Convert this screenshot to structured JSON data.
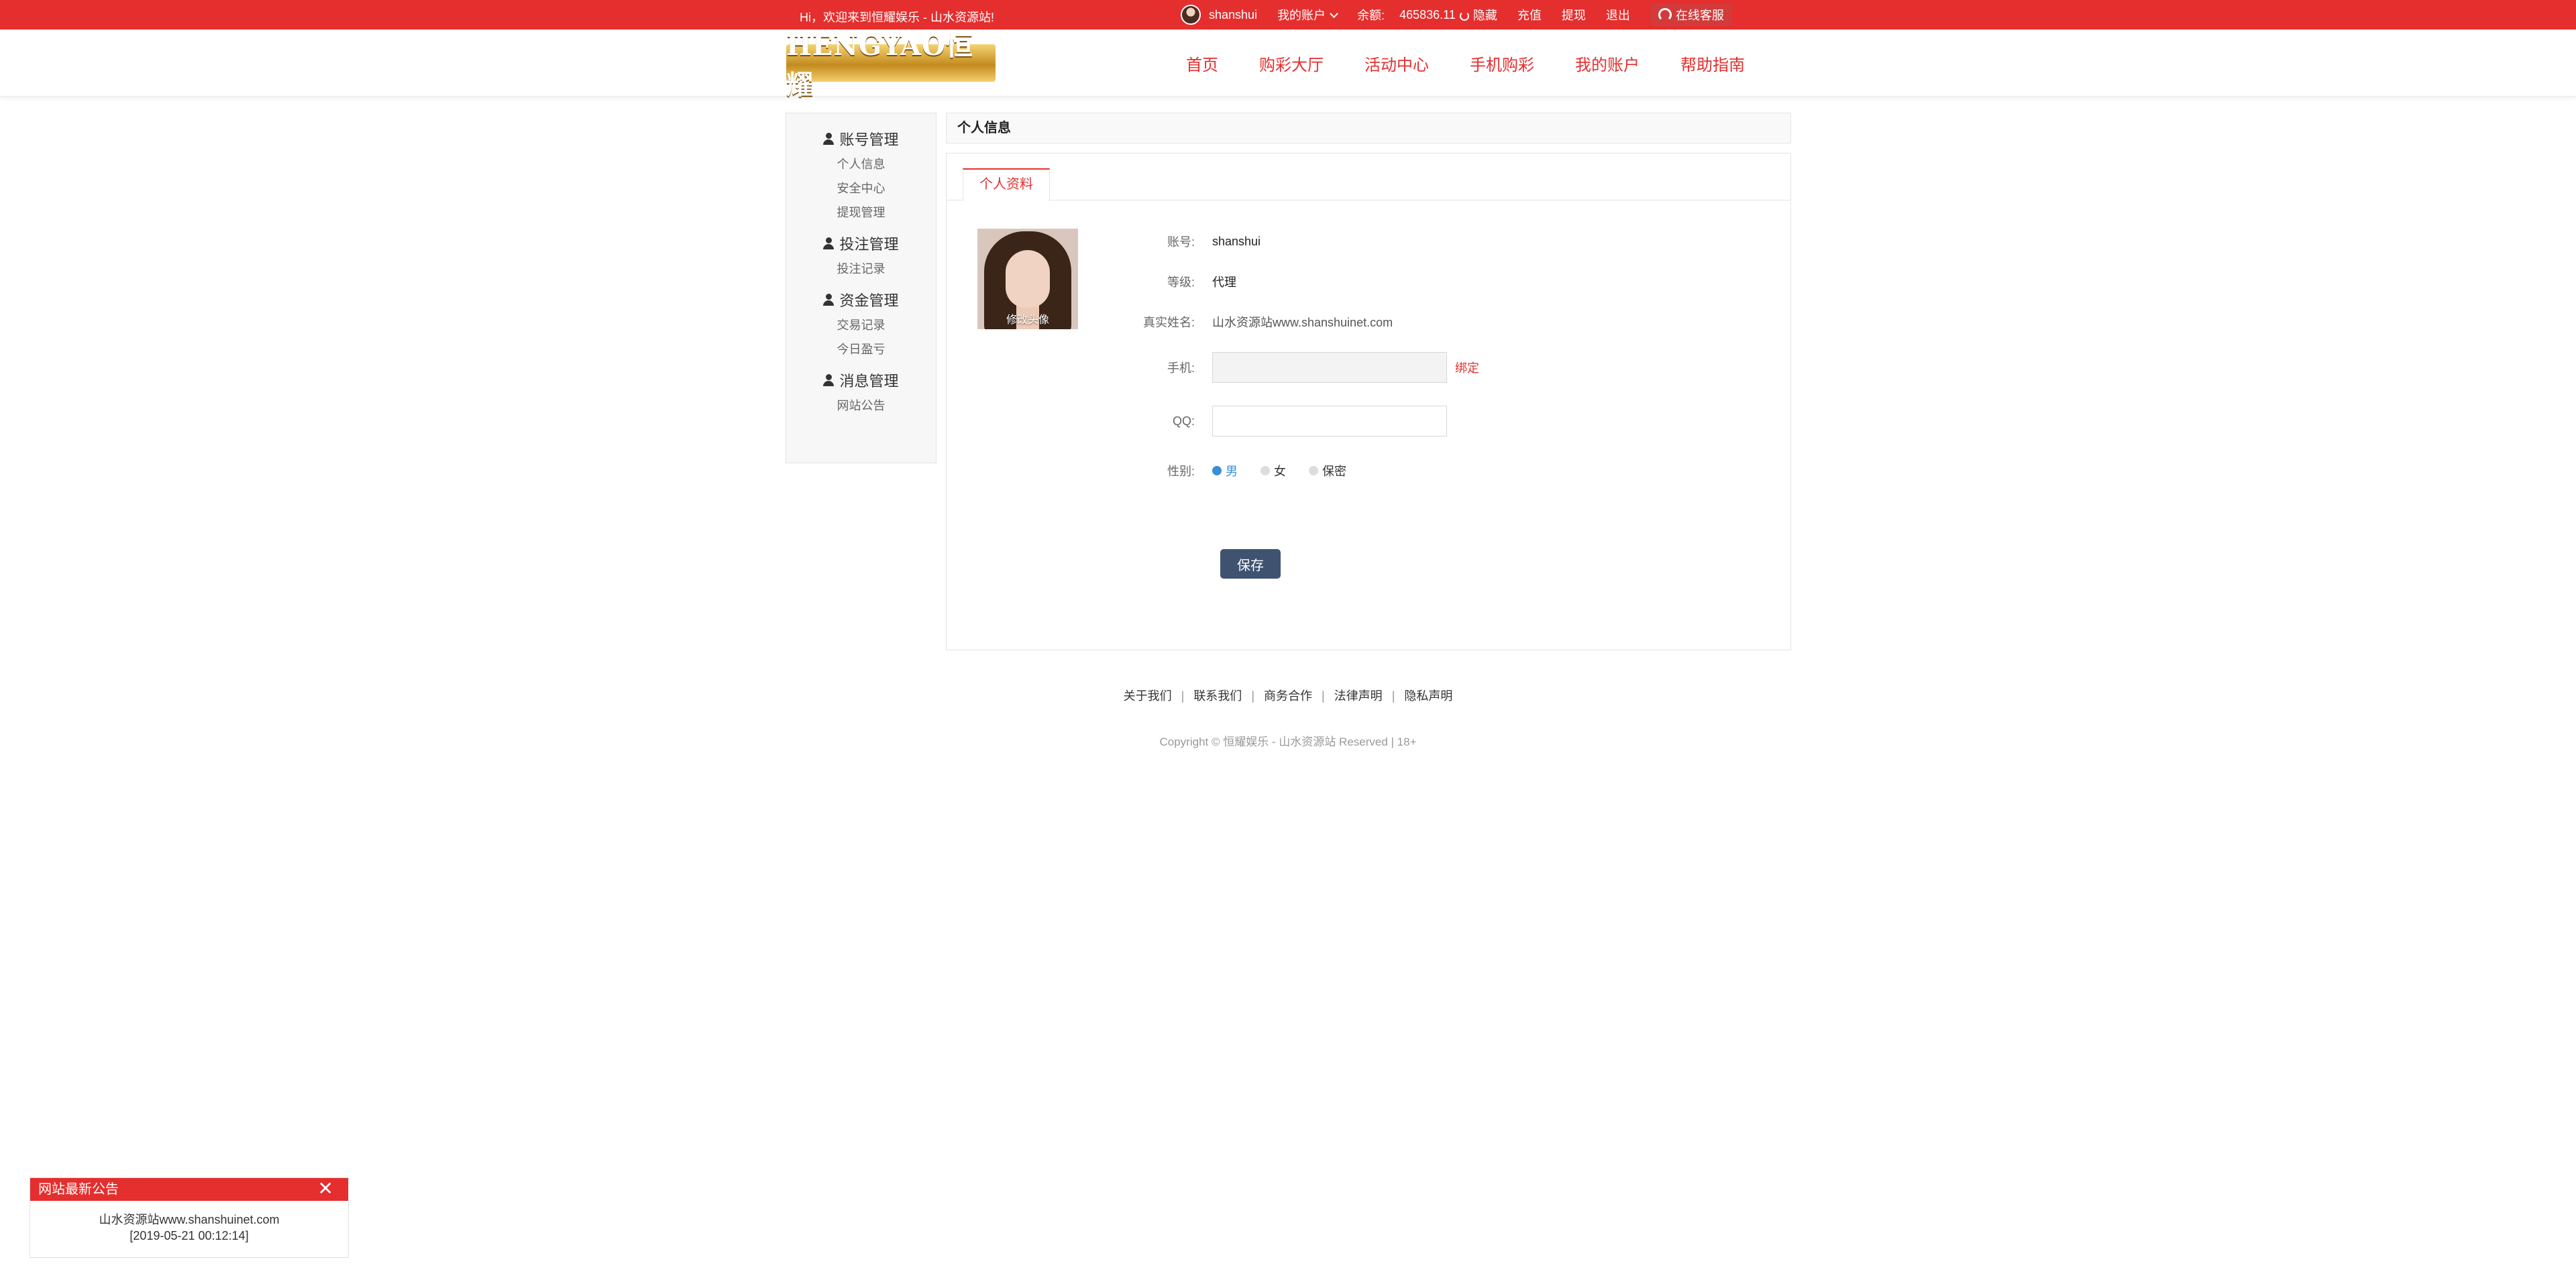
{
  "topbar": {
    "welcome": "Hi，欢迎来到恒耀娱乐 - 山水资源站!",
    "username": "shanshui",
    "my_account": "我的账户",
    "balance_label": "余额:",
    "balance_value": "465836.11",
    "hide": "隐藏",
    "recharge": "充值",
    "withdraw": "提现",
    "logout": "退出",
    "service": "在线客服"
  },
  "header": {
    "logo_text": "HENGYAO恒耀",
    "nav": [
      "首页",
      "购彩大厅",
      "活动中心",
      "手机购彩",
      "我的账户",
      "帮助指南"
    ]
  },
  "sidebar": {
    "groups": [
      {
        "title": "账号管理",
        "items": [
          "个人信息",
          "安全中心",
          "提现管理"
        ]
      },
      {
        "title": "投注管理",
        "items": [
          "投注记录"
        ]
      },
      {
        "title": "资金管理",
        "items": [
          "交易记录",
          "今日盈亏"
        ]
      },
      {
        "title": "消息管理",
        "items": [
          "网站公告"
        ]
      }
    ]
  },
  "main": {
    "title": "个人信息",
    "tab": "个人资料",
    "avatar_label": "修改头像",
    "fields": {
      "account_label": "账号:",
      "account_value": "shanshui",
      "level_label": "等级:",
      "level_value": "代理",
      "realname_label": "真实姓名:",
      "realname_value": "山水资源站www.shanshuinet.com",
      "phone_label": "手机:",
      "phone_value": "",
      "bind_link": "绑定",
      "qq_label": "QQ:",
      "qq_value": "",
      "gender_label": "性别:",
      "gender_options": [
        "男",
        "女",
        "保密"
      ],
      "gender_selected": "男"
    },
    "save_label": "保存"
  },
  "footer": {
    "links": [
      "关于我们",
      "联系我们",
      "商务合作",
      "法律声明",
      "隐私声明"
    ],
    "copyright": "Copyright © 恒耀娱乐 - 山水资源站 Reserved | 18+"
  },
  "notice": {
    "title": "网站最新公告",
    "close": "✕",
    "text": "山水资源站www.shanshuinet.com",
    "date": "[2019-05-21 00:12:14]"
  },
  "colors": {
    "brand_red": "#e52e2e",
    "save_button": "#3f5371",
    "radio_selected": "#3a8fd6"
  }
}
